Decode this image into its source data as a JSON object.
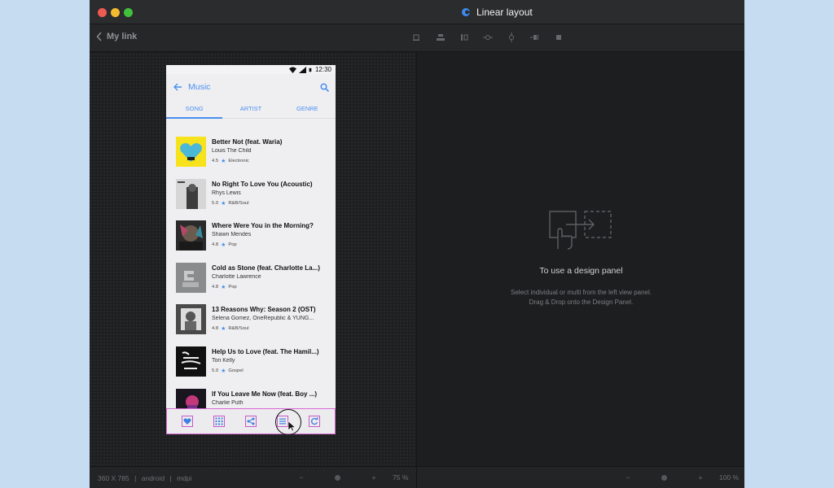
{
  "window": {
    "title": "Linear layout"
  },
  "toolbar": {
    "back_label": "My link"
  },
  "phone": {
    "time": "12:30",
    "app_title": "Music",
    "tabs": [
      "SONG",
      "ARTIST",
      "GENRE"
    ],
    "songs": [
      {
        "title": "Better Not (feat. Waria)",
        "artist": "Louis The Child",
        "rating": "4.5",
        "genre": "Electronic"
      },
      {
        "title": "No Right To Love You (Acoustic)",
        "artist": "Rhys Lewis",
        "rating": "5.0",
        "genre": "R&B/Soul"
      },
      {
        "title": "Where Were You in the Morning?",
        "artist": "Shawn Mendes",
        "rating": "4.8",
        "genre": "Pop"
      },
      {
        "title": "Cold as Stone (feat. Charlotte La...)",
        "artist": "Charlotte Lawrence",
        "rating": "4.8",
        "genre": "Pop"
      },
      {
        "title": "13 Reasons Why: Season 2 (OST)",
        "artist": "Selena Gomez, OneRepublic & YUNG...",
        "rating": "4.8",
        "genre": "R&B/Soul"
      },
      {
        "title": "Help Us to Love (feat. The Hamil...)",
        "artist": "Tori Kelly",
        "rating": "5.0",
        "genre": "Gospel"
      },
      {
        "title": "If You Leave Me Now (feat. Boy ...)",
        "artist": "Charlie Puth",
        "rating": "",
        "genre": ""
      }
    ],
    "bottom_icons": [
      "heart-icon",
      "grid-icon",
      "share-icon",
      "list-icon",
      "refresh-icon"
    ]
  },
  "design_panel": {
    "title": "To use a design panel",
    "line1": "Select individual or multi from the left view panel.",
    "line2": "Drag & Drop onto the Design Panel."
  },
  "statusbar": {
    "dimensions": "360 X 785",
    "platform": "android",
    "density": "mdpi",
    "left_zoom": "75 %",
    "right_zoom": "100 %",
    "minus": "−",
    "plus": "+"
  },
  "colors": {
    "accent": "#4a8ff0",
    "selection": "#d96ad5"
  }
}
